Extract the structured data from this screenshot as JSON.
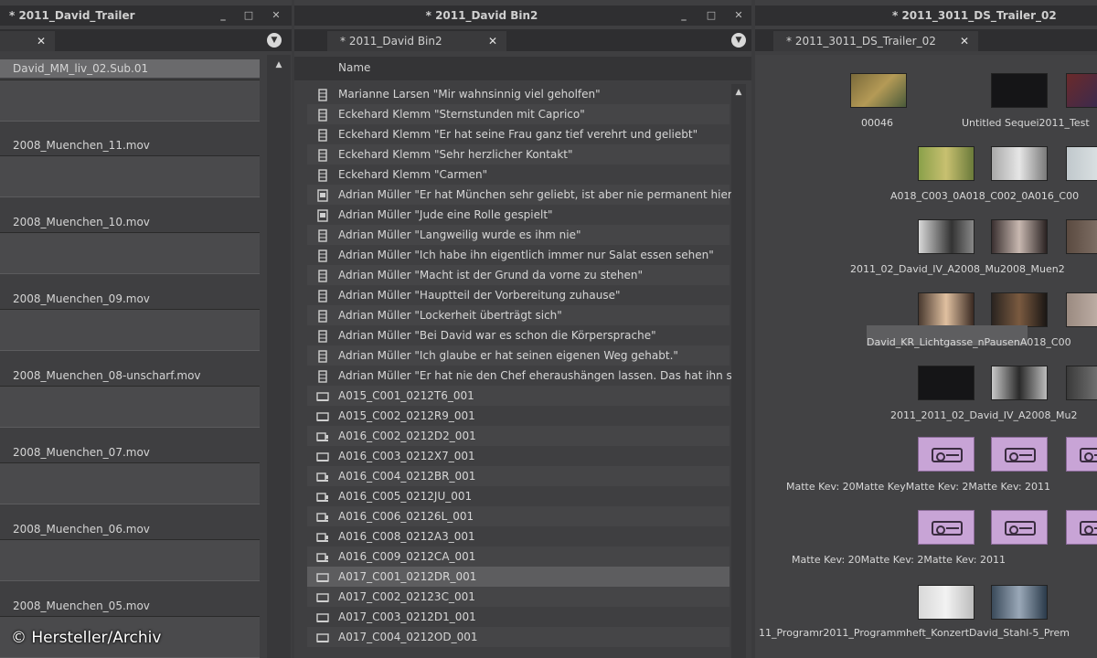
{
  "left_panel": {
    "title": "* 2011_David_Trailer",
    "close": "✕",
    "items": [
      {
        "label": "David_MM_liv_02.Sub.01"
      },
      {
        "label": "2008_Muenchen_11.mov"
      },
      {
        "label": "2008_Muenchen_10.mov"
      },
      {
        "label": "2008_Muenchen_09.mov"
      },
      {
        "label": "2008_Muenchen_08-unscharf.mov"
      },
      {
        "label": "2008_Muenchen_07.mov"
      },
      {
        "label": "2008_Muenchen_06.mov"
      },
      {
        "label": "2008_Muenchen_05.mov"
      }
    ]
  },
  "middle_panel": {
    "title": "* 2011_David Bin2",
    "tab": "* 2011_David Bin2",
    "close": "✕",
    "column_header": "Name",
    "rows": [
      {
        "icon": "subclip-icon",
        "label": "Marianne Larsen \"Mir wahnsinnig viel geholfen\""
      },
      {
        "icon": "subclip-icon",
        "label": "Eckehard Klemm \"Sternstunden mit Caprico\""
      },
      {
        "icon": "subclip-icon",
        "label": "Eckehard Klemm \"Er hat seine Frau ganz tief verehrt und geliebt\""
      },
      {
        "icon": "subclip-icon",
        "label": "Eckehard Klemm \"Sehr herzlicher Kontakt\""
      },
      {
        "icon": "subclip-icon",
        "label": "Eckehard Klemm \"Carmen\""
      },
      {
        "icon": "doc-icon",
        "label": "Adrian Müller \"Er hat München sehr geliebt, ist aber nie permanent hierh"
      },
      {
        "icon": "doc-icon",
        "label": "Adrian Müller \"Jude eine Rolle gespielt\""
      },
      {
        "icon": "subclip-icon",
        "label": "Adrian Müller \"Langweilig wurde es ihm nie\""
      },
      {
        "icon": "subclip-icon",
        "label": "Adrian Müller \"Ich habe ihn eigentlich immer nur Salat essen sehen\""
      },
      {
        "icon": "subclip-icon",
        "label": "Adrian Müller \"Macht ist der Grund da vorne zu stehen\""
      },
      {
        "icon": "subclip-icon",
        "label": "Adrian Müller \"Hauptteil der Vorbereitung zuhause\""
      },
      {
        "icon": "subclip-icon",
        "label": "Adrian Müller \"Lockerheit überträgt sich\""
      },
      {
        "icon": "subclip-icon",
        "label": "Adrian Müller \"Bei David war es schon die Körpersprache\""
      },
      {
        "icon": "subclip-icon",
        "label": "Adrian Müller \"Ich glaube er hat seinen eigenen Weg gehabt.\""
      },
      {
        "icon": "subclip-icon",
        "label": "Adrian Müller \"Er hat nie den Chef eheraushängen lassen. Das hat ihn se"
      },
      {
        "icon": "clip-icon",
        "label": "A015_C001_0212T6_001"
      },
      {
        "icon": "clip-icon",
        "label": "A015_C002_0212R9_001"
      },
      {
        "icon": "clip-audio-icon",
        "label": "A016_C002_0212D2_001"
      },
      {
        "icon": "clip-icon",
        "label": "A016_C003_0212X7_001"
      },
      {
        "icon": "clip-audio-icon",
        "label": "A016_C004_0212BR_001"
      },
      {
        "icon": "clip-audio-icon",
        "label": "A016_C005_0212JU_001"
      },
      {
        "icon": "clip-audio-icon",
        "label": "A016_C006_02126L_001"
      },
      {
        "icon": "clip-audio-icon",
        "label": "A016_C008_0212A3_001"
      },
      {
        "icon": "clip-audio-icon",
        "label": "A016_C009_0212CA_001"
      },
      {
        "icon": "clip-icon",
        "label": "A017_C001_0212DR_001"
      },
      {
        "icon": "clip-icon",
        "label": "A017_C002_02123C_001"
      },
      {
        "icon": "clip-icon",
        "label": "A017_C003_0212D1_001"
      },
      {
        "icon": "clip-icon",
        "label": "A017_C004_0212OD_001"
      }
    ]
  },
  "right_panel": {
    "title": "* 2011_3011_DS_Trailer_02",
    "tab": "* 2011_3011_DS_Trailer_02",
    "close": "✕",
    "captions": [
      {
        "text": "00046"
      },
      {
        "text": "Untitled Sequei2011_Test"
      },
      {
        "text": "A018_C003_0A018_C002_0A016_C00"
      },
      {
        "text": "2011_02_David_IV_A2008_Mu2008_Muen2"
      },
      {
        "text": "David_KR_Lichtgasse_nPausenA018_C00"
      },
      {
        "text": "2011_2011_02_David_IV_A2008_Mu2"
      },
      {
        "text": "Matte Kev: 20Matte KeyMatte Kev: 2Matte Kev: 2011"
      },
      {
        "text": "Matte Kev: 20Matte Kev: 2Matte Kev: 2011"
      },
      {
        "text": "11_Programr2011_Programmheft_KonzertDavid_Stahl-5_Prem"
      }
    ],
    "colors": {
      "matte_key": "#c8a4d6"
    }
  },
  "watermark": "© Hersteller/Archiv"
}
